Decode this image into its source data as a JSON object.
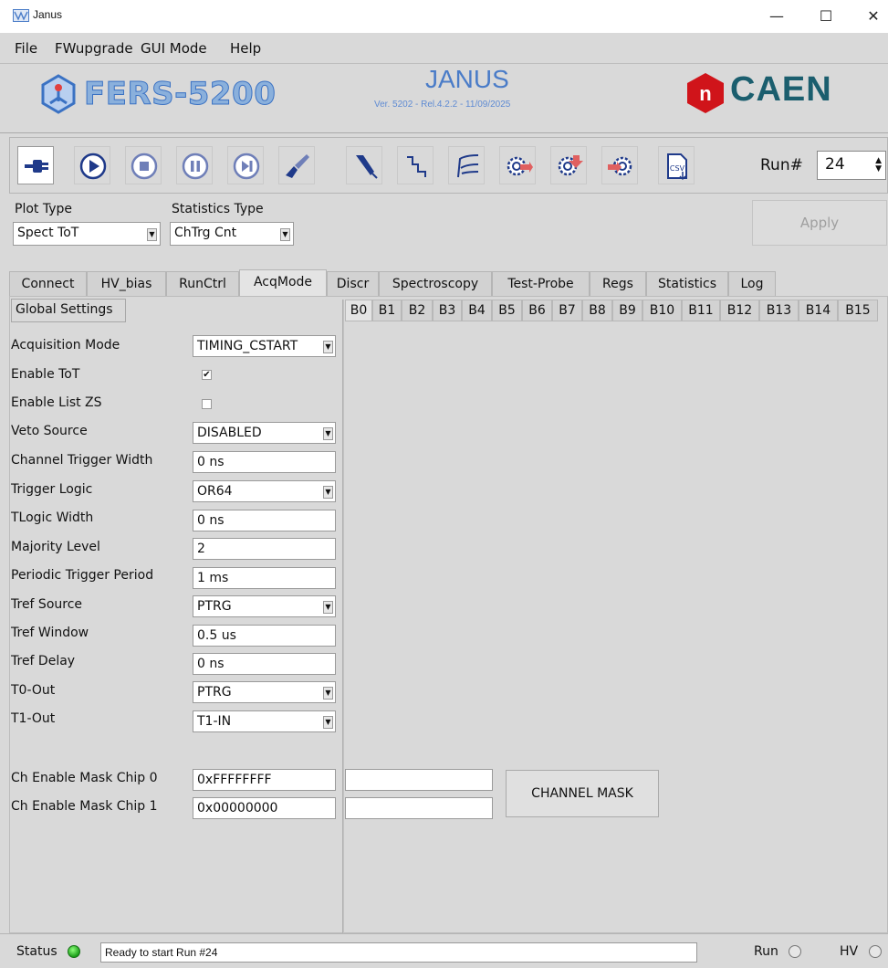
{
  "window": {
    "title": "Janus"
  },
  "menu": [
    "File",
    "FWupgrade",
    "GUI Mode",
    "Help"
  ],
  "banner": {
    "product": "FERS-5200",
    "app_name": "JANUS",
    "version": "Ver. 5202 - Rel.4.2.2 - 11/09/2025",
    "brand": "CAEN",
    "brand_mark": "n"
  },
  "toolbar": {
    "buttons": [
      {
        "name": "connect-icon"
      },
      {
        "name": "play-icon"
      },
      {
        "name": "stop-icon"
      },
      {
        "name": "pause-icon"
      },
      {
        "name": "step-icon"
      },
      {
        "name": "brush-icon"
      },
      {
        "name": "probe-icon"
      },
      {
        "name": "step-signal-icon"
      },
      {
        "name": "waveform-icon"
      },
      {
        "name": "gear-save-icon"
      },
      {
        "name": "gear-upload-icon"
      },
      {
        "name": "gear-arrow-icon"
      },
      {
        "name": "csv-icon"
      }
    ],
    "run_label": "Run#",
    "run_value": "24"
  },
  "plot": {
    "plot_type_label": "Plot Type",
    "plot_type_value": "Spect ToT",
    "stats_type_label": "Statistics Type",
    "stats_type_value": "ChTrg Cnt",
    "apply_label": "Apply"
  },
  "tabs": [
    "Connect",
    "HV_bias",
    "RunCtrl",
    "AcqMode",
    "Discr",
    "Spectroscopy",
    "Test-Probe",
    "Regs",
    "Statistics",
    "Log"
  ],
  "active_tab": "AcqMode",
  "global_settings_label": "Global Settings",
  "board_tabs": [
    "B0",
    "B1",
    "B2",
    "B3",
    "B4",
    "B5",
    "B6",
    "B7",
    "B8",
    "B9",
    "B10",
    "B11",
    "B12",
    "B13",
    "B14",
    "B15"
  ],
  "form": {
    "acq_mode": {
      "label": "Acquisition Mode",
      "value": "TIMING_CSTART"
    },
    "enable_tot": {
      "label": "Enable ToT",
      "checked": true
    },
    "enable_list_zs": {
      "label": "Enable List ZS",
      "checked": false
    },
    "veto_source": {
      "label": "Veto Source",
      "value": "DISABLED"
    },
    "ch_trigger_width": {
      "label": "Channel Trigger Width",
      "value": "0 ns"
    },
    "trigger_logic": {
      "label": "Trigger Logic",
      "value": "OR64"
    },
    "tlogic_width": {
      "label": "TLogic Width",
      "value": "0 ns"
    },
    "majority_level": {
      "label": "Majority Level",
      "value": "2"
    },
    "periodic_trigger": {
      "label": "Periodic Trigger Period",
      "value": "1 ms"
    },
    "tref_source": {
      "label": "Tref Source",
      "value": "PTRG"
    },
    "tref_window": {
      "label": "Tref Window",
      "value": "0.5 us"
    },
    "tref_delay": {
      "label": "Tref Delay",
      "value": "0 ns"
    },
    "t0_out": {
      "label": "T0-Out",
      "value": "PTRG"
    },
    "t1_out": {
      "label": "T1-Out",
      "value": "T1-IN"
    },
    "mask_chip0": {
      "label": "Ch Enable Mask Chip 0",
      "value": "0xFFFFFFFF"
    },
    "mask_chip1": {
      "label": "Ch Enable Mask Chip 1",
      "value": "0x00000000"
    },
    "channel_mask_button": "CHANNEL MASK"
  },
  "status": {
    "label": "Status",
    "text": "Ready to start Run #24",
    "run_label": "Run",
    "hv_label": "HV"
  },
  "colors": {
    "status_ok": "#1b9e19",
    "caen_red": "#d0141a",
    "caen_teal": "#1b5e6e",
    "janus_blue": "#4a7cc8"
  }
}
